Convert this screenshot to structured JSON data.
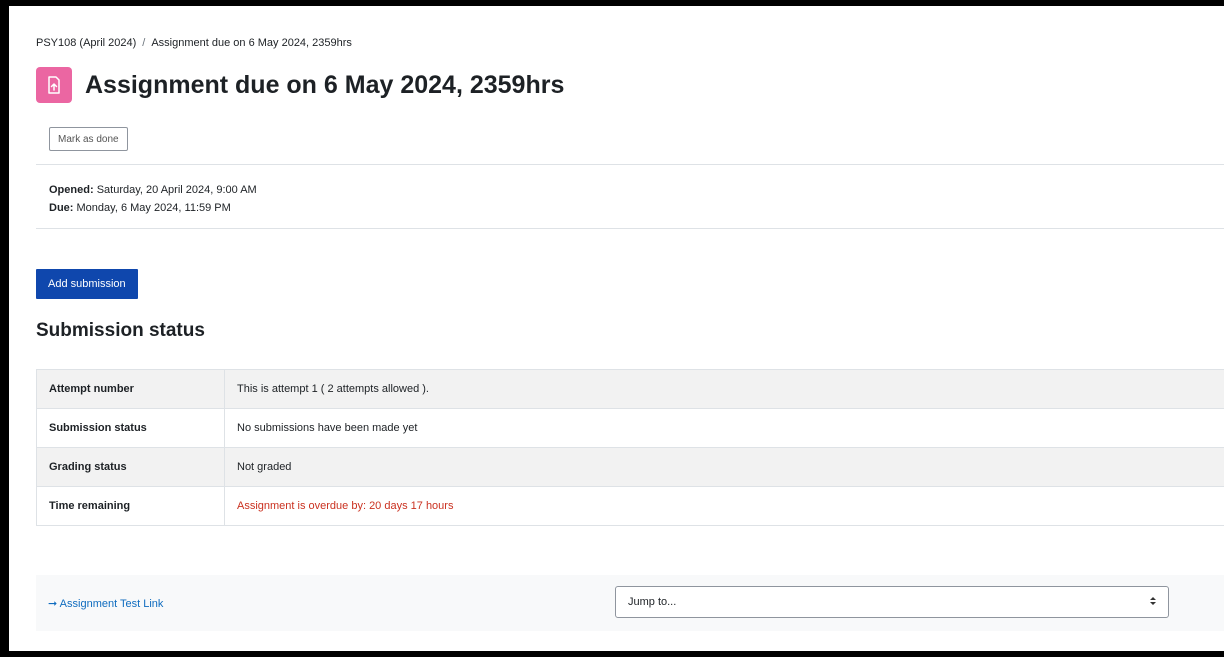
{
  "breadcrumb": {
    "course": "PSY108 (April 2024)",
    "separator": "/",
    "current": "Assignment due on 6 May 2024, 2359hrs"
  },
  "activity": {
    "icon": "assignment-upload-icon",
    "icon_color": "#eb66a2",
    "title": "Assignment due on 6 May 2024, 2359hrs"
  },
  "mark_as_done_label": "Mark as done",
  "dates": {
    "opened_label": "Opened:",
    "opened_value": "Saturday, 20 April 2024, 9:00 AM",
    "due_label": "Due:",
    "due_value": "Monday, 6 May 2024, 11:59 PM"
  },
  "add_submission_label": "Add submission",
  "submission_status": {
    "heading": "Submission status",
    "rows": [
      {
        "key": "Attempt number",
        "value": "This is attempt 1 ( 2 attempts allowed )."
      },
      {
        "key": "Submission status",
        "value": "No submissions have been made yet"
      },
      {
        "key": "Grading status",
        "value": "Not graded"
      },
      {
        "key": "Time remaining",
        "value": "Assignment is overdue by: 20 days 17 hours"
      }
    ]
  },
  "footer": {
    "prev_activity_arrow": "➞",
    "prev_activity_label": "Assignment Test Link",
    "jump_to_placeholder": "Jump to..."
  },
  "colors": {
    "primary_button": "#0f47ad",
    "overdue_text": "#ca3120",
    "link": "#0f6cbf"
  }
}
